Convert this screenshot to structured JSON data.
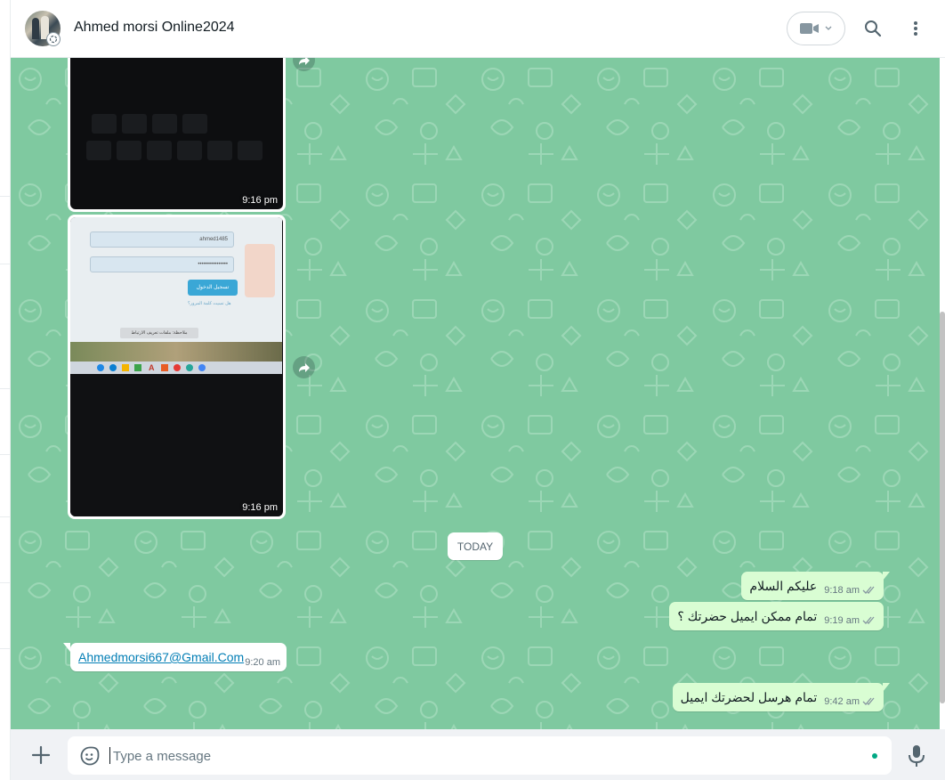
{
  "header": {
    "contact_name": "Ahmed morsi Online2024"
  },
  "images": [
    {
      "time": "9:16 pm"
    },
    {
      "time": "9:16 pm",
      "screen_field_1": "ahmed1485",
      "screen_field_2": "••••••••••••••••",
      "screen_button": "تسجيل الدخول",
      "screen_link": "هل نسيت كلمة المرور؟",
      "screen_notice": "ملاحظة: ملفات تعريف الارتباط"
    }
  ],
  "date_divider": "TODAY",
  "messages": [
    {
      "direction": "out",
      "text": "عليكم السلام",
      "time": "9:18 am",
      "status": "read"
    },
    {
      "direction": "out",
      "text": "تمام ممكن ايميل حضرتك ؟",
      "time": "9:19 am",
      "status": "read"
    },
    {
      "direction": "in",
      "text": "Ahmedmorsi667@Gmail.Com",
      "time": "9:20 am"
    },
    {
      "direction": "out",
      "text": "تمام هرسل لحضرتك ايميل",
      "time": "9:42 am",
      "status": "read"
    }
  ],
  "composer": {
    "placeholder": "Type a message"
  },
  "colors": {
    "chat_background": "#7fc9a0",
    "outgoing_bubble": "#d9fdd3",
    "incoming_bubble": "#ffffff",
    "link": "#027eb5",
    "accent": "#00a884"
  },
  "icons": [
    "video-call-icon",
    "search-icon",
    "menu-icon",
    "forward-icon",
    "plus-icon",
    "sticker-icon",
    "mic-icon",
    "double-check-icon"
  ]
}
